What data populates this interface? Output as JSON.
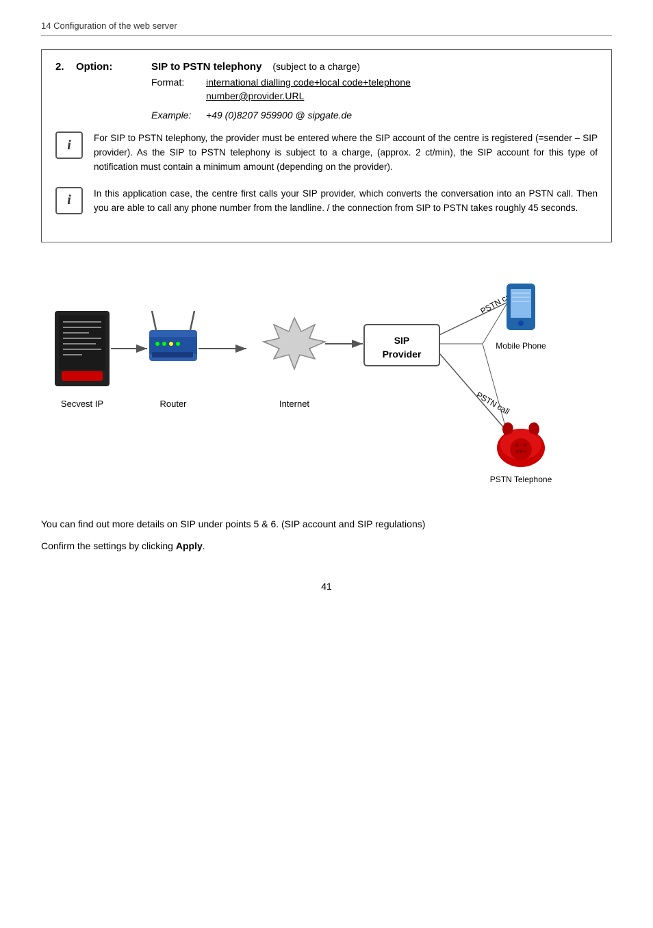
{
  "header": {
    "text": "14  Configuration of the web server"
  },
  "option": {
    "number": "2.",
    "label": "Option:",
    "title": "SIP to PSTN telephony",
    "subtitle": "(subject to a charge)",
    "format_label": "Format:",
    "format_line1": "international dialling code+local code+telephone",
    "format_line2": "number@provider.URL",
    "example_label": "Example:",
    "example_value": "+49 (0)8207 959900 @ sipgate.de"
  },
  "info1": {
    "icon": "i",
    "text": "For SIP to PSTN telephony, the provider must be entered where the SIP account of the centre is registered (=sender – SIP provider). As the SIP to PSTN telephony is subject to a charge, (approx. 2 ct/min), the SIP account for this type of notification must contain a minimum amount (depending on the provider)."
  },
  "info2": {
    "icon": "i",
    "text": "In this application case, the centre first calls your SIP provider, which converts the conversation into an PSTN call.  Then you are able to call any phone number from the landline.  / the connection from SIP to PSTN takes roughly 45 seconds."
  },
  "diagram": {
    "secvest_label": "Secvest IP",
    "router_label": "Router",
    "internet_label": "Internet",
    "sip_label": "SIP",
    "sip_label2": "Provider",
    "mobile_label": "Mobile Phone",
    "pstn_label": "PSTN Telephone",
    "pstn_call1": "PSTN call",
    "pstn_call2": "PSTN call"
  },
  "bottom": {
    "text1": "You  can  find  out  more  details  on  SIP  under  points  5  &  6. (SIP account and SIP regulations)",
    "text2": "Confirm the settings by clicking ",
    "text2_bold": "Apply",
    "text2_end": "."
  },
  "page_number": "41"
}
